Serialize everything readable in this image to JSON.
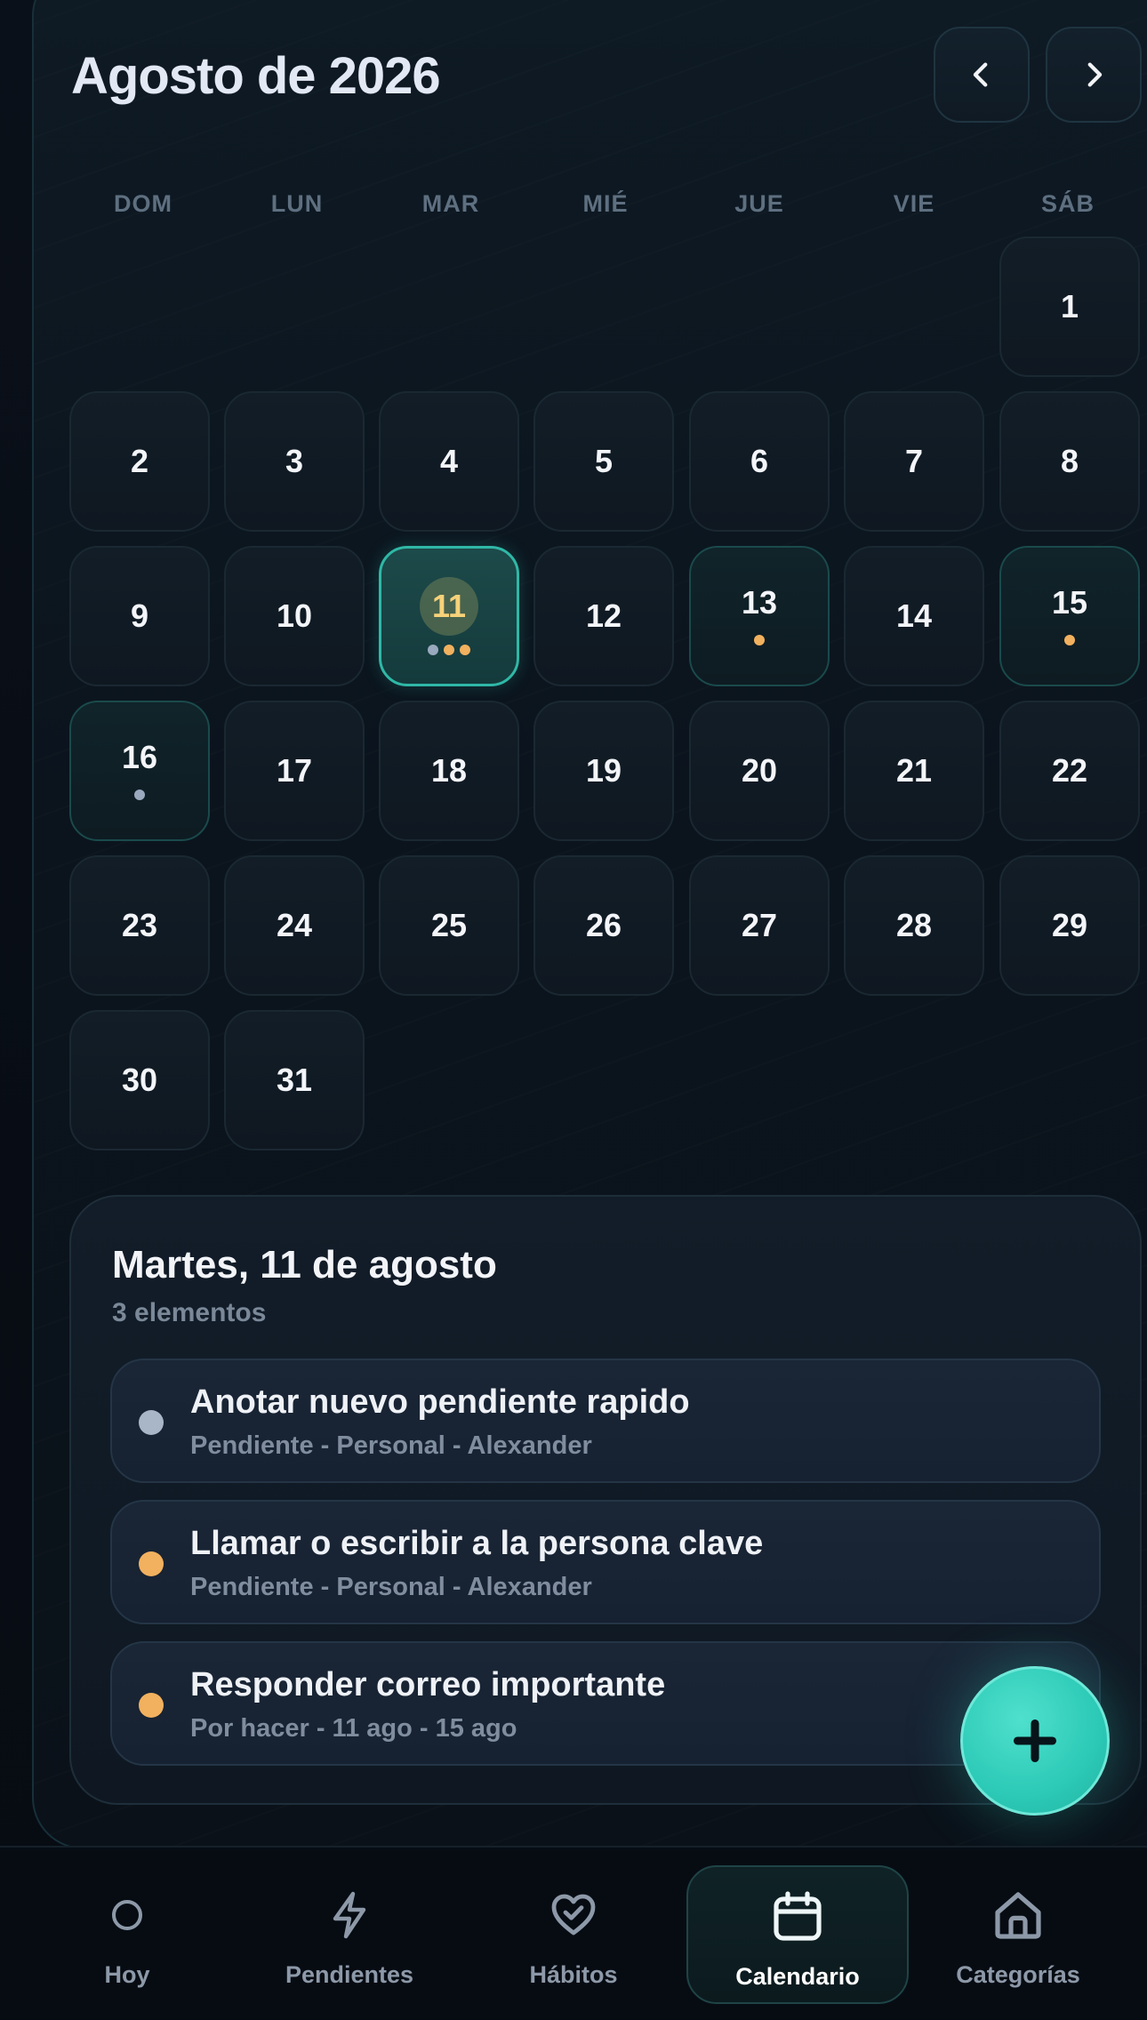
{
  "header": {
    "month_title": "Agosto de 2026",
    "prev_glyph": "‹",
    "next_glyph": "›"
  },
  "weekdays": [
    "DOM",
    "LUN",
    "MAR",
    "MIÉ",
    "JUE",
    "VIE",
    "SÁB"
  ],
  "calendar": {
    "first_weekday_index": 6,
    "days_in_month": 31,
    "selected_day": 11,
    "markers": {
      "11": [
        "gray",
        "orange",
        "orange"
      ],
      "13": [
        "orange"
      ],
      "15": [
        "orange"
      ],
      "16": [
        "gray"
      ]
    }
  },
  "agenda": {
    "title": "Martes, 11 de agosto",
    "count": "3 elementos",
    "items": [
      {
        "title": "Anotar nuevo pendiente rapido",
        "meta": "Pendiente - Personal - Alexander",
        "color": "gray"
      },
      {
        "title": "Llamar o escribir a la persona clave",
        "meta": "Pendiente - Personal - Alexander",
        "color": "orange"
      },
      {
        "title": "Responder correo importante",
        "meta": "Por hacer - 11 ago - 15 ago",
        "color": "orange"
      }
    ]
  },
  "fab": {
    "icon": "plus-icon"
  },
  "tabs": [
    {
      "label": "Hoy",
      "icon": "circle-icon"
    },
    {
      "label": "Pendientes",
      "icon": "bolt-icon"
    },
    {
      "label": "Hábitos",
      "icon": "heart-check-icon"
    },
    {
      "label": "Calendario",
      "icon": "calendar-icon",
      "active": true
    },
    {
      "label": "Categorías",
      "icon": "home-icon"
    }
  ],
  "colors": {
    "accent": "#2ccab7",
    "orange": "#f2b15e",
    "gray": "#9aa9bd",
    "background": "#070b12"
  }
}
